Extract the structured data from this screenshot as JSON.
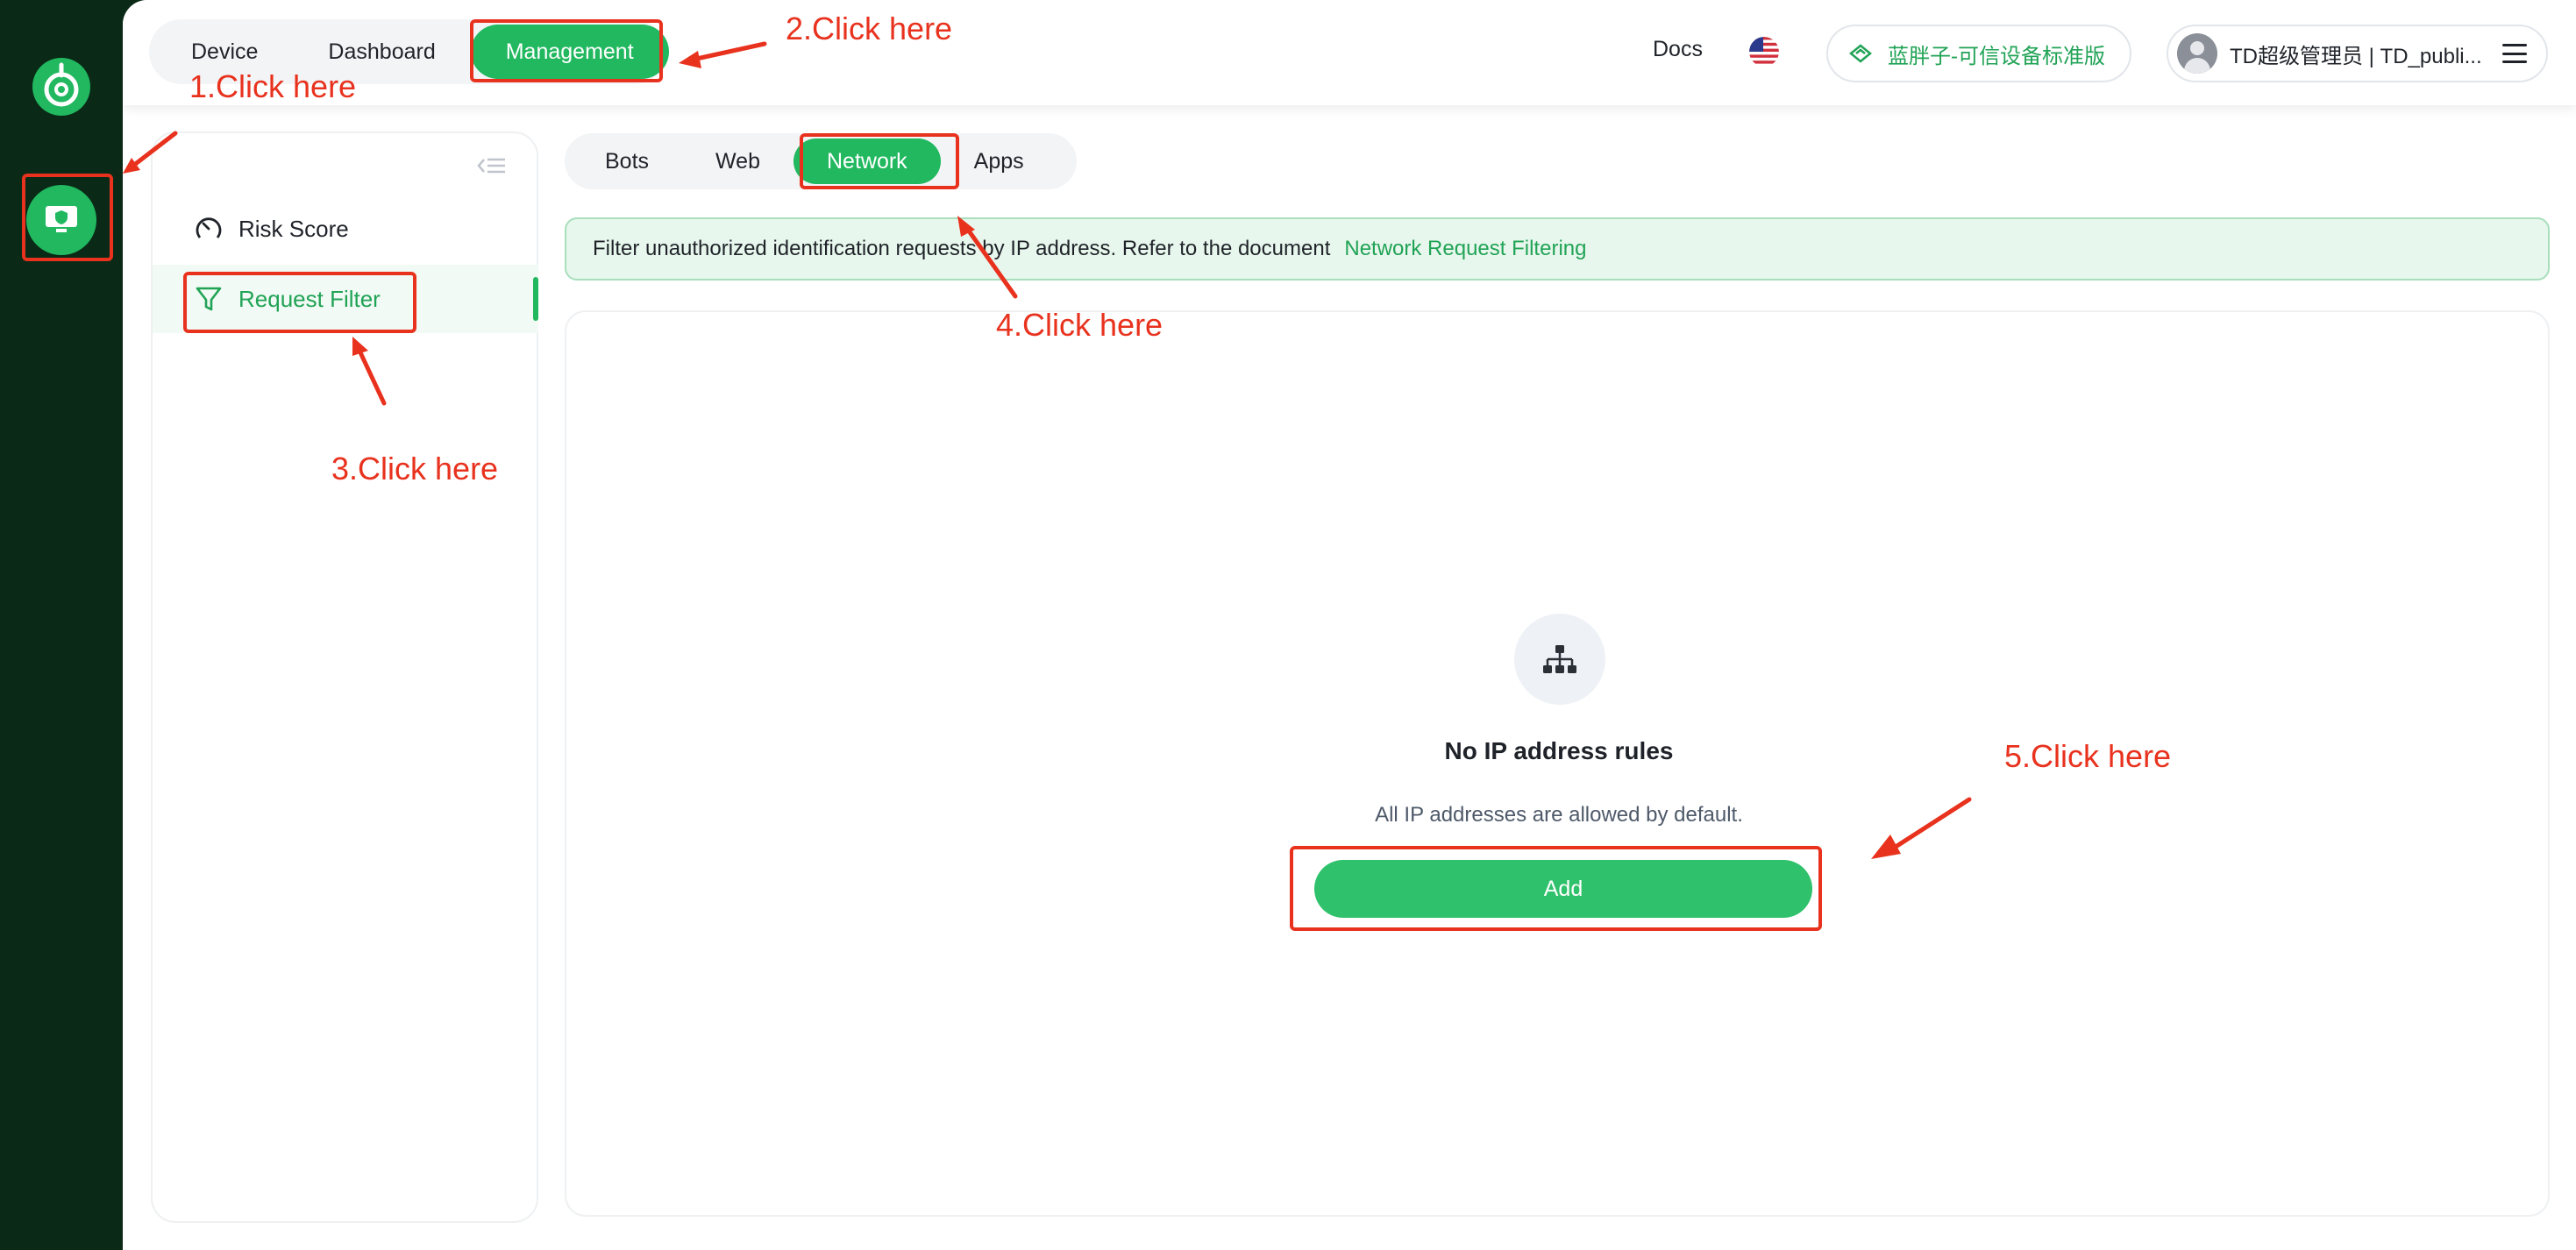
{
  "topbar": {
    "tabs": [
      {
        "label": "Device"
      },
      {
        "label": "Dashboard"
      },
      {
        "label": "Management"
      }
    ],
    "docs_label": "Docs",
    "plan_label": "蓝胖子-可信设备标准版",
    "user_label": "TD超级管理员 | TD_publi..."
  },
  "sidebar": {
    "items": [
      {
        "label": "Risk Score"
      },
      {
        "label": "Request Filter"
      }
    ]
  },
  "subtabs": [
    {
      "label": "Bots"
    },
    {
      "label": "Web"
    },
    {
      "label": "Network"
    },
    {
      "label": "Apps"
    }
  ],
  "banner": {
    "text": "Filter unauthorized identification requests by IP address. Refer to the document",
    "link": "Network Request Filtering"
  },
  "empty_state": {
    "title": "No IP address rules",
    "description": "All IP addresses are allowed by default.",
    "button_label": "Add"
  },
  "annotations": [
    "1.Click here",
    "2.Click here",
    "3.Click here",
    "4.Click here",
    "5.Click here"
  ],
  "colors": {
    "brand_green": "#21b85f",
    "rail_dark": "#0a2a17",
    "annotation_red": "#e8321e"
  }
}
